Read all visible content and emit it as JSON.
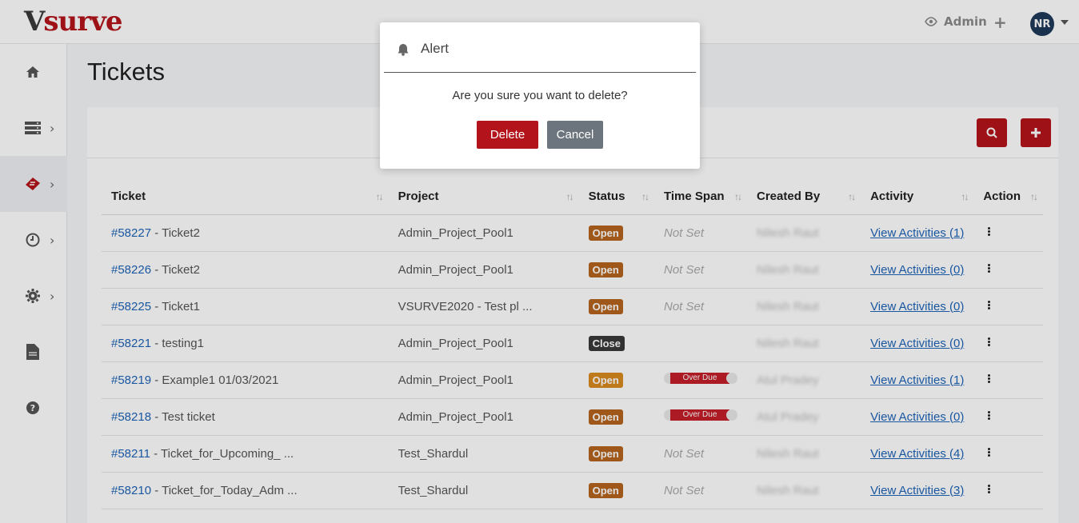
{
  "header": {
    "logo_v": "V",
    "logo_rest": "surve",
    "admin_label": "Admin",
    "plus_label": "+",
    "avatar_initials": "NR"
  },
  "sidebar": {
    "items": [
      {
        "icon": "home-icon",
        "has_chevron": false
      },
      {
        "icon": "server-icon",
        "has_chevron": true
      },
      {
        "icon": "ticket-icon",
        "has_chevron": true,
        "active": true
      },
      {
        "icon": "clock-icon",
        "has_chevron": true
      },
      {
        "icon": "gear-icon",
        "has_chevron": true
      },
      {
        "icon": "file-icon",
        "has_chevron": false
      },
      {
        "icon": "help-icon",
        "has_chevron": false
      }
    ]
  },
  "page": {
    "title": "Tickets"
  },
  "toolbar": {
    "search_icon": "search-icon",
    "add_icon": "plus-icon"
  },
  "table": {
    "columns": [
      "Ticket",
      "Project",
      "Status",
      "Time Span",
      "Created By",
      "Activity",
      "Action"
    ],
    "rows": [
      {
        "id": "#58227",
        "title": " - Ticket2",
        "project": "Admin_Project_Pool1",
        "status": "Open",
        "status_color": "#b5651d",
        "timespan": "Not Set",
        "created_by": "Nilesh Raut",
        "activity": "View Activities (1)"
      },
      {
        "id": "#58226",
        "title": " - Ticket2",
        "project": "Admin_Project_Pool1",
        "status": "Open",
        "status_color": "#b5651d",
        "timespan": "Not Set",
        "created_by": "Nilesh Raut",
        "activity": "View Activities (0)"
      },
      {
        "id": "#58225",
        "title": " - Ticket1",
        "project": "VSURVE2020 - Test pl ...",
        "status": "Open",
        "status_color": "#b5651d",
        "timespan": "Not Set",
        "created_by": "Nilesh Raut",
        "activity": "View Activities (0)"
      },
      {
        "id": "#58221",
        "title": " - testing1",
        "project": "Admin_Project_Pool1",
        "status": "Close",
        "status_color": "#3a3a3a",
        "timespan": "",
        "created_by": "Nilesh Raut",
        "activity": "View Activities (0)"
      },
      {
        "id": "#58219",
        "title": " - Example1 01/03/2021",
        "project": "Admin_Project_Pool1",
        "status": "Open",
        "status_color": "#d98a1e",
        "timespan": "Over Due",
        "created_by": "Atul Pradey",
        "activity": "View Activities (1)"
      },
      {
        "id": "#58218",
        "title": " - Test ticket",
        "project": "Admin_Project_Pool1",
        "status": "Open",
        "status_color": "#b5651d",
        "timespan": "Over Due",
        "created_by": "Atul Pradey",
        "activity": "View Activities (0)"
      },
      {
        "id": "#58211",
        "title": " - Ticket_for_Upcoming_ ...",
        "project": "Test_Shardul",
        "status": "Open",
        "status_color": "#b5651d",
        "timespan": "Not Set",
        "created_by": "Nilesh Raut",
        "activity": "View Activities (4)"
      },
      {
        "id": "#58210",
        "title": " - Ticket_for_Today_Adm ...",
        "project": "Test_Shardul",
        "status": "Open",
        "status_color": "#b5651d",
        "timespan": "Not Set",
        "created_by": "Nilesh Raut",
        "activity": "View Activities (3)"
      }
    ]
  },
  "modal": {
    "title": "Alert",
    "message": "Are you sure you want to delete?",
    "delete_label": "Delete",
    "cancel_label": "Cancel"
  },
  "colors": {
    "brand": "#b3141b",
    "link": "#1d63b8",
    "cancel": "#6c757d"
  }
}
